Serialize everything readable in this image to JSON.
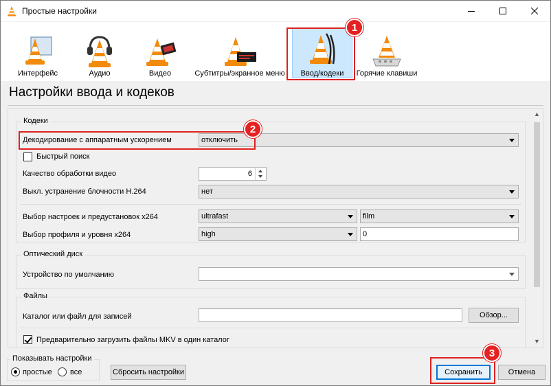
{
  "window": {
    "title": "Простые настройки",
    "controls": [
      "minimize-icon",
      "maximize-icon",
      "close-icon"
    ]
  },
  "toolbar": {
    "items": [
      {
        "label": "Интерфейс",
        "icon": "vlc-cone-interface-icon"
      },
      {
        "label": "Аудио",
        "icon": "vlc-cone-headphones-icon"
      },
      {
        "label": "Видео",
        "icon": "vlc-cone-film-icon"
      },
      {
        "label": "Субтитры/экранное меню",
        "icon": "vlc-cone-subtitles-icon"
      },
      {
        "label": "Ввод/кодеки",
        "icon": "vlc-cone-cables-icon",
        "selected": true
      },
      {
        "label": "Горячие клавиши",
        "icon": "vlc-cone-keyboard-icon"
      }
    ]
  },
  "annotations": {
    "badge1": "1",
    "badge2": "2",
    "badge3": "3",
    "color": "#e52121"
  },
  "page": {
    "heading": "Настройки ввода и кодеков"
  },
  "codecs": {
    "title": "Кодеки",
    "hw_decoding_label": "Декодирование с аппаратным ускорением",
    "hw_decoding_value": "отключить",
    "fast_seek_label": "Быстрый поиск",
    "fast_seek_checked": false,
    "video_quality_label": "Качество обработки видео",
    "video_quality_value": "6",
    "h264_deblock_label": "Выкл. устранение блочности H.264",
    "h264_deblock_value": "нет",
    "x264_preset_label": "Выбор настроек и предустановок x264",
    "x264_preset_value": "ultrafast",
    "x264_tune_value": "film",
    "x264_profile_label": "Выбор профиля и уровня x264",
    "x264_profile_value": "high",
    "x264_level_value": "0"
  },
  "optical": {
    "title": "Оптический диск",
    "default_device_label": "Устройство по умолчанию",
    "default_device_value": ""
  },
  "files": {
    "title": "Файлы",
    "record_dir_label": "Каталог или файл для записей",
    "record_dir_value": "",
    "browse_label": "Обзор...",
    "preload_mkv_label": "Предварительно загрузить файлы MKV в один каталог",
    "preload_mkv_checked": true
  },
  "footer": {
    "show_settings_title": "Показывать настройки",
    "simple_label": "простые",
    "all_label": "все",
    "selected_mode": "простые",
    "reset_label": "Сбросить настройки",
    "save_label": "Сохранить",
    "cancel_label": "Отмена"
  }
}
